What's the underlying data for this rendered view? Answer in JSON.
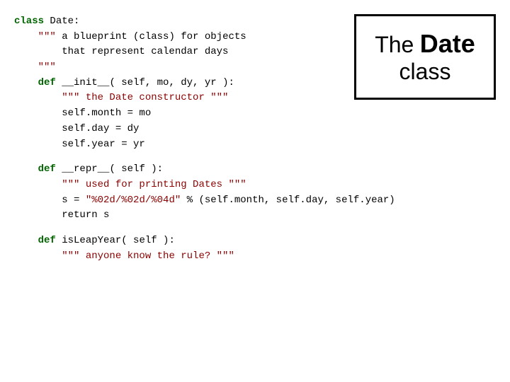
{
  "title_box": {
    "the": "The",
    "date": "Date",
    "class": "class"
  },
  "code": {
    "lines": [
      {
        "id": "line1",
        "content": "class Date:"
      },
      {
        "id": "line2",
        "content": "    \"\"\" a blueprint (class) for objects"
      },
      {
        "id": "line3",
        "content": "        that represent calendar days"
      },
      {
        "id": "line4",
        "content": "    \"\"\""
      },
      {
        "id": "line5",
        "content": "    def __init__( self, mo, dy, yr ):"
      },
      {
        "id": "line6",
        "content": "        \"\"\" the Date constructor \"\"\""
      },
      {
        "id": "line7",
        "content": "        self.month = mo"
      },
      {
        "id": "line8",
        "content": "        self.day = dy"
      },
      {
        "id": "line9",
        "content": "        self.year = yr"
      },
      {
        "id": "spacer1",
        "content": ""
      },
      {
        "id": "line10",
        "content": "    def __repr__( self ):"
      },
      {
        "id": "line11",
        "content": "        \"\"\" used for printing Dates \"\"\""
      },
      {
        "id": "line12",
        "content": "        s = \"%02d/%02d/%04d\" % (self.month, self.day, self.year)"
      },
      {
        "id": "line13",
        "content": "        return s"
      },
      {
        "id": "spacer2",
        "content": ""
      },
      {
        "id": "line14",
        "content": "    def isLeapYear( self ):"
      },
      {
        "id": "line15",
        "content": "        \"\"\" anyone know the rule? \"\"\""
      }
    ]
  }
}
